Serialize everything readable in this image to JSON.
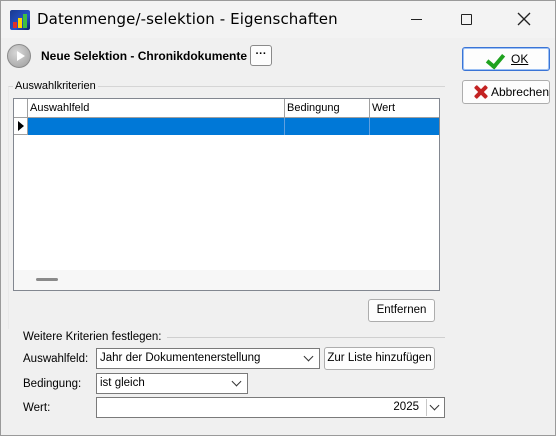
{
  "window": {
    "title": "Datenmenge/-selektion - Eigenschaften"
  },
  "header": {
    "selection_title": "Neue Selektion - Chronikdokumente",
    "more_label": "···"
  },
  "actions": {
    "ok_label": "OK",
    "cancel_label": "Abbrechen"
  },
  "criteria": {
    "group_title": "Auswahlkriterien",
    "columns": [
      "Auswahlfeld",
      "Bedingung",
      "Wert"
    ],
    "rows": [
      {
        "field": "",
        "condition": "",
        "value": ""
      }
    ],
    "remove_label": "Entfernen"
  },
  "further": {
    "title": "Weitere Kriterien festlegen:",
    "field_label": "Auswahlfeld:",
    "field_value": "Jahr der Dokumentenerstellung",
    "add_label": "Zur Liste hinzufügen",
    "condition_label": "Bedingung:",
    "condition_value": "ist gleich",
    "value_label": "Wert:",
    "value_value": "2025"
  },
  "colors": {
    "selection": "#0078d7",
    "ok_accent": "#1fa21f",
    "cancel_accent": "#c32222"
  }
}
